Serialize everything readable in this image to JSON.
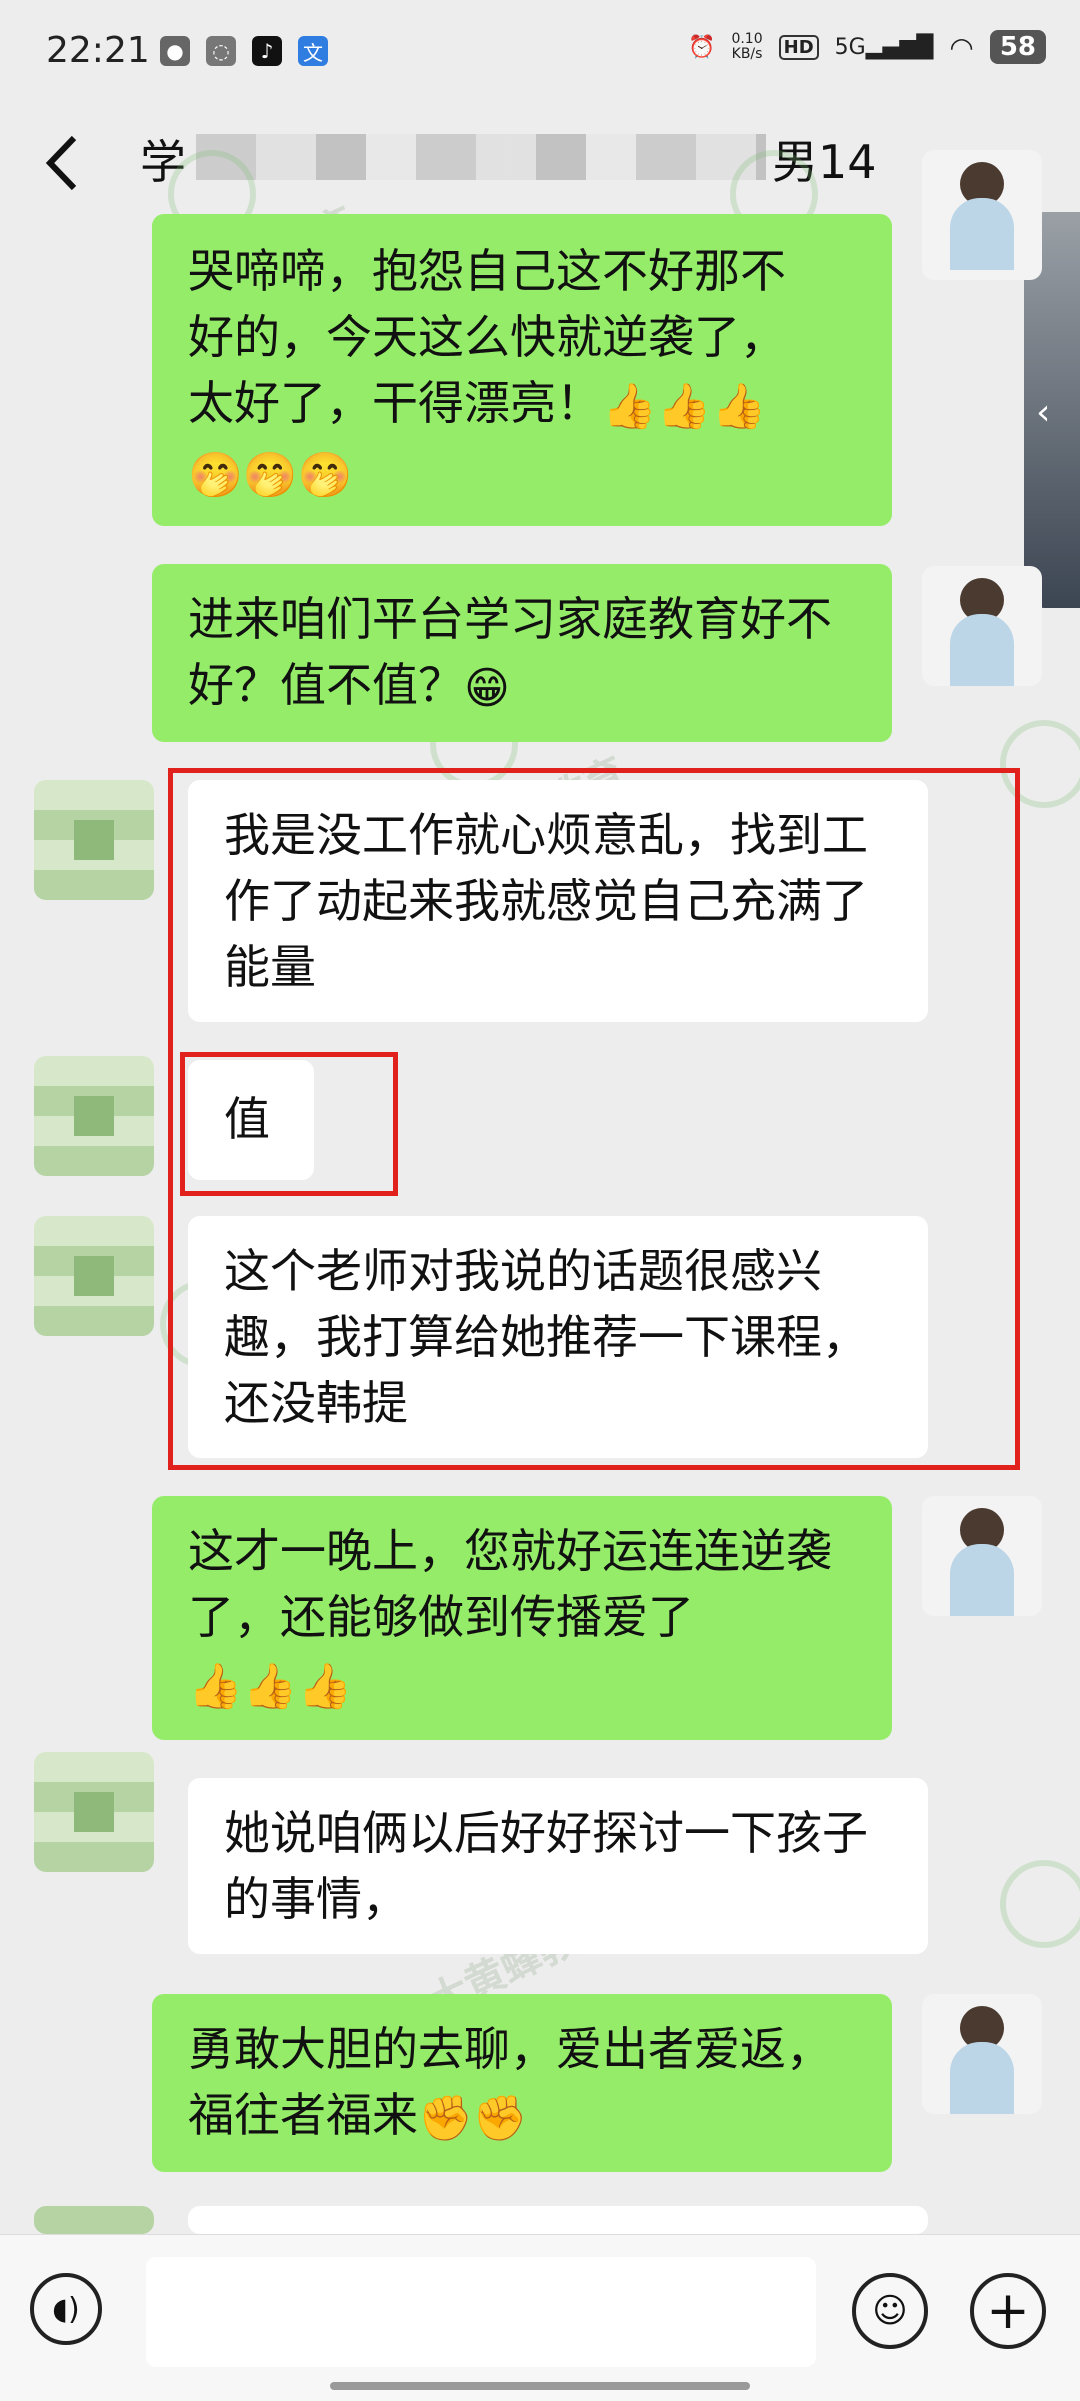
{
  "status_bar": {
    "time": "22:21",
    "net_speed_value": "0.10",
    "net_speed_unit": "KB/s",
    "hd": "HD",
    "signal": "5G",
    "battery": "58",
    "left_icons": [
      "wechat-icon",
      "message-icon",
      "tiktok-icon",
      "translate-icon"
    ]
  },
  "header": {
    "title_prefix": "学",
    "title_suffix": "男14",
    "more_label": "···"
  },
  "messages": [
    {
      "side": "out",
      "lines": [
        "哭啼啼，抱怨自己这不好那不",
        "好的，今天这么快就逆袭了，",
        "太好了，干得漂亮！"
      ],
      "emoji": "👍👍👍",
      "emoji2": "🤭🤭🤭"
    },
    {
      "side": "out",
      "text": "进来咱们平台学习家庭教育好不好？值不值？",
      "emoji": "😁"
    },
    {
      "side": "in",
      "text": "我是没工作就心烦意乱，找到工作了动起来我就感觉自己充满了能量"
    },
    {
      "side": "in",
      "text": "值"
    },
    {
      "side": "in",
      "text": "这个老师对我说的话题很感兴趣，我打算给她推荐一下课程，还没韩提"
    },
    {
      "side": "out",
      "text": "这才一晚上，您就好运连连逆袭了，还能够做到传播爱了",
      "emoji": "👍👍👍"
    },
    {
      "side": "in",
      "text": "她说咱俩以后好好探讨一下孩子的事情，"
    },
    {
      "side": "out",
      "text": "勇敢大胆的去聊，爱出者爱返，福往者福来",
      "emoji": "✊✊"
    }
  ],
  "watermark": "大黄蜂教育",
  "colors": {
    "outgoing_bubble": "#95ec69",
    "incoming_bubble": "#ffffff",
    "highlight_box": "#e0211c",
    "background": "#ededed"
  },
  "input_bar": {
    "voice_icon": "voice-icon",
    "emoji_icon": "emoji-icon",
    "plus_icon": "plus-icon"
  }
}
